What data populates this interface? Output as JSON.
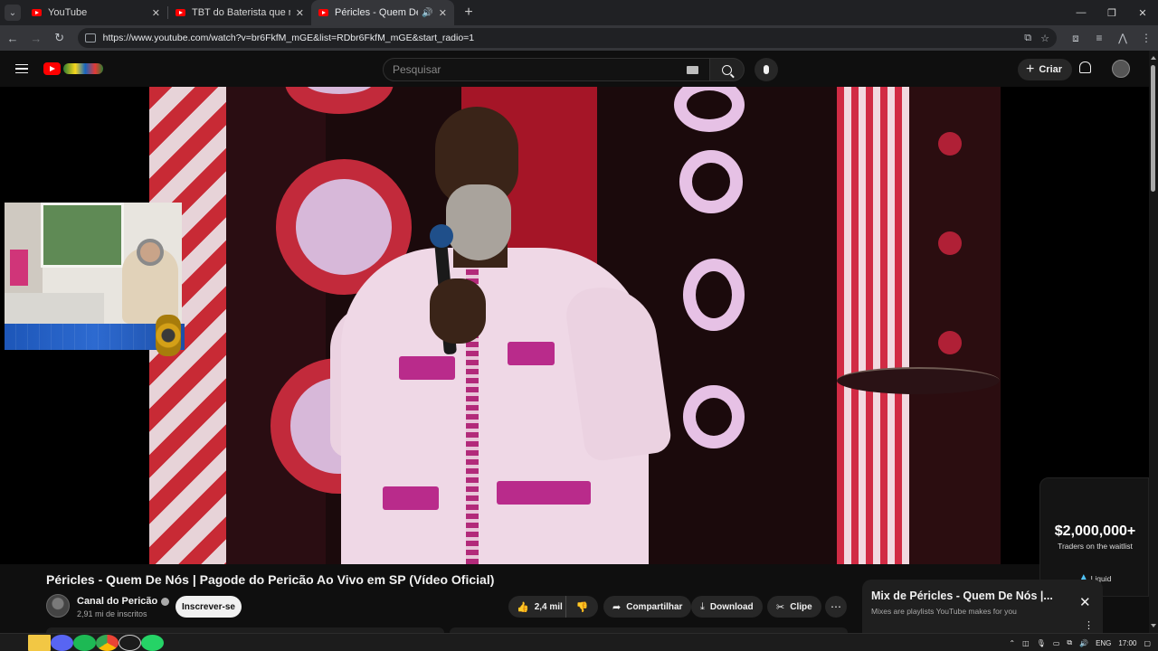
{
  "browser": {
    "tabs": [
      {
        "title": "YouTube",
        "active": false,
        "audio": false
      },
      {
        "title": "TBT do Baterista que não sabia",
        "active": false,
        "audio": false
      },
      {
        "title": "Péricles - Quem De Nós | P",
        "active": true,
        "audio": true
      }
    ],
    "url": "https://www.youtube.com/watch?v=br6FkfM_mGE&list=RDbr6FkfM_mGE&start_radio=1"
  },
  "masthead": {
    "search_placeholder": "Pesquisar",
    "create_label": "Criar"
  },
  "video": {
    "title": "Péricles - Quem De Nós | Pagode do Pericão Ao Vivo em SP (Vídeo Oficial)",
    "channel_name": "Canal do Pericão",
    "subscribers": "2,91 mi de inscritos",
    "subscribe_label": "Inscrever-se",
    "like_count": "2,4 mil",
    "share_label": "Compartilhar",
    "download_label": "Download",
    "clip_label": "Clipe"
  },
  "ad": {
    "headline": "$2,000,000+",
    "subline": "Traders on the waitlist",
    "brand": "Liquid"
  },
  "mix": {
    "title": "Mix de Péricles - Quem De Nós |...",
    "subtitle": "Mixes are playlists YouTube makes for you"
  },
  "taskbar": {
    "language": "ENG",
    "time": "17:00"
  },
  "colors": {
    "youtube_red": "#ff0000",
    "background": "#0f0f0f",
    "chip": "#272727"
  }
}
